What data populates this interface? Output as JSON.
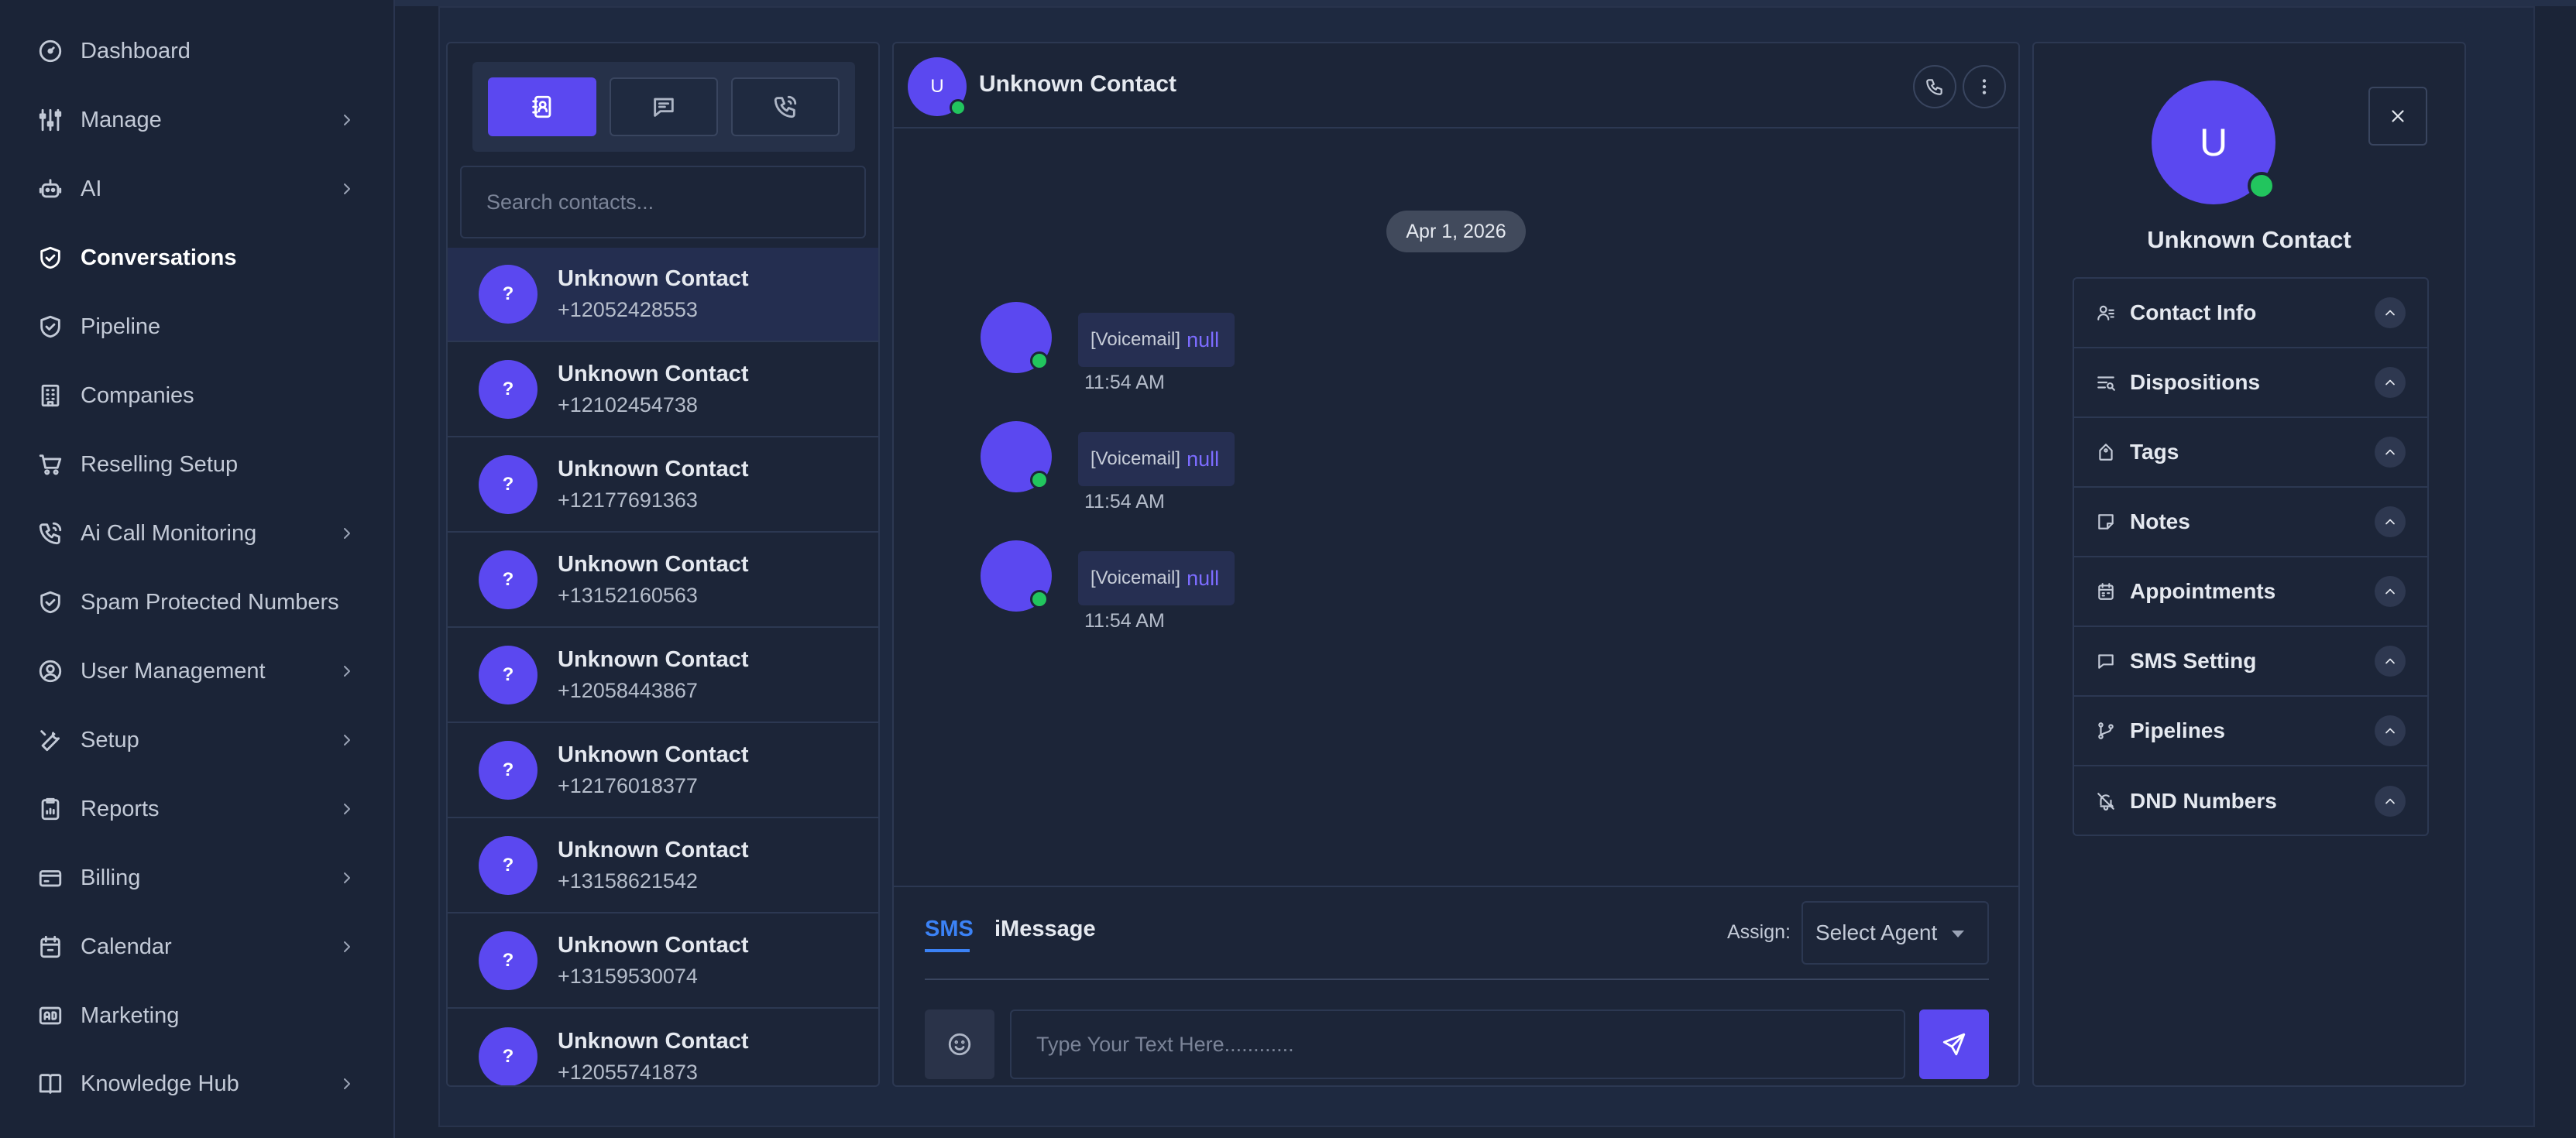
{
  "sidebar": {
    "items": [
      {
        "label": "Dashboard",
        "icon": "gauge-icon",
        "has_submenu": false
      },
      {
        "label": "Manage",
        "icon": "sliders-icon",
        "has_submenu": true
      },
      {
        "label": "AI",
        "icon": "robot-icon",
        "has_submenu": true
      },
      {
        "label": "Conversations",
        "icon": "shield-check-icon",
        "has_submenu": false,
        "active": true
      },
      {
        "label": "Pipeline",
        "icon": "shield-check-icon",
        "has_submenu": false
      },
      {
        "label": "Companies",
        "icon": "building-icon",
        "has_submenu": false
      },
      {
        "label": "Reselling Setup",
        "icon": "cart-icon",
        "has_submenu": false
      },
      {
        "label": "Ai Call Monitoring",
        "icon": "phone-call-icon",
        "has_submenu": true
      },
      {
        "label": "Spam Protected Numbers",
        "icon": "shield-check-icon",
        "has_submenu": false
      },
      {
        "label": "User Management",
        "icon": "user-circle-icon",
        "has_submenu": true
      },
      {
        "label": "Setup",
        "icon": "wrench-icon",
        "has_submenu": true
      },
      {
        "label": "Reports",
        "icon": "report-icon",
        "has_submenu": true
      },
      {
        "label": "Billing",
        "icon": "credit-card-icon",
        "has_submenu": true
      },
      {
        "label": "Calendar",
        "icon": "calendar-icon",
        "has_submenu": true
      },
      {
        "label": "Marketing",
        "icon": "ad-icon",
        "has_submenu": false
      },
      {
        "label": "Knowledge Hub",
        "icon": "book-icon",
        "has_submenu": true
      }
    ]
  },
  "contacts": {
    "tabs": [
      {
        "name": "contacts-tab",
        "icon": "contact-book-icon",
        "active": true
      },
      {
        "name": "messages-tab",
        "icon": "message-icon",
        "active": false
      },
      {
        "name": "calls-tab",
        "icon": "phone-call-icon",
        "active": false
      }
    ],
    "search_placeholder": "Search contacts...",
    "list": [
      {
        "avatar": "?",
        "name": "Unknown Contact",
        "phone": "+12052428553",
        "selected": true
      },
      {
        "avatar": "?",
        "name": "Unknown Contact",
        "phone": "+12102454738"
      },
      {
        "avatar": "?",
        "name": "Unknown Contact",
        "phone": "+12177691363"
      },
      {
        "avatar": "?",
        "name": "Unknown Contact",
        "phone": "+13152160563"
      },
      {
        "avatar": "?",
        "name": "Unknown Contact",
        "phone": "+12058443867"
      },
      {
        "avatar": "?",
        "name": "Unknown Contact",
        "phone": "+12176018377"
      },
      {
        "avatar": "?",
        "name": "Unknown Contact",
        "phone": "+13158621542"
      },
      {
        "avatar": "?",
        "name": "Unknown Contact",
        "phone": "+13159530074"
      },
      {
        "avatar": "?",
        "name": "Unknown Contact",
        "phone": "+12055741873"
      }
    ]
  },
  "chat": {
    "header": {
      "avatar": "U",
      "name": "Unknown Contact"
    },
    "date_divider": "Apr 1, 2026",
    "messages": [
      {
        "type": "[Voicemail]",
        "content": "null",
        "time": "11:54 AM"
      },
      {
        "type": "[Voicemail]",
        "content": "null",
        "time": "11:54 AM"
      },
      {
        "type": "[Voicemail]",
        "content": "null",
        "time": "11:54 AM"
      }
    ],
    "composer": {
      "channels": [
        "SMS",
        "iMessage"
      ],
      "active_channel": "SMS",
      "assign_label": "Assign:",
      "agent_select": "Select Agent",
      "input_placeholder": "Type Your Text Here............"
    }
  },
  "details": {
    "avatar": "U",
    "name": "Unknown Contact",
    "sections": [
      {
        "label": "Contact Info",
        "icon": "user-lines-icon"
      },
      {
        "label": "Dispositions",
        "icon": "list-filter-icon"
      },
      {
        "label": "Tags",
        "icon": "tag-icon"
      },
      {
        "label": "Notes",
        "icon": "sticky-note-icon"
      },
      {
        "label": "Appointments",
        "icon": "calendar-icon"
      },
      {
        "label": "SMS Setting",
        "icon": "message-icon"
      },
      {
        "label": "Pipelines",
        "icon": "branch-icon"
      },
      {
        "label": "DND Numbers",
        "icon": "bell-off-icon"
      }
    ]
  },
  "colors": {
    "accent": "#5b48f0",
    "online": "#22c55e",
    "sms_tab": "#3b82f6"
  }
}
